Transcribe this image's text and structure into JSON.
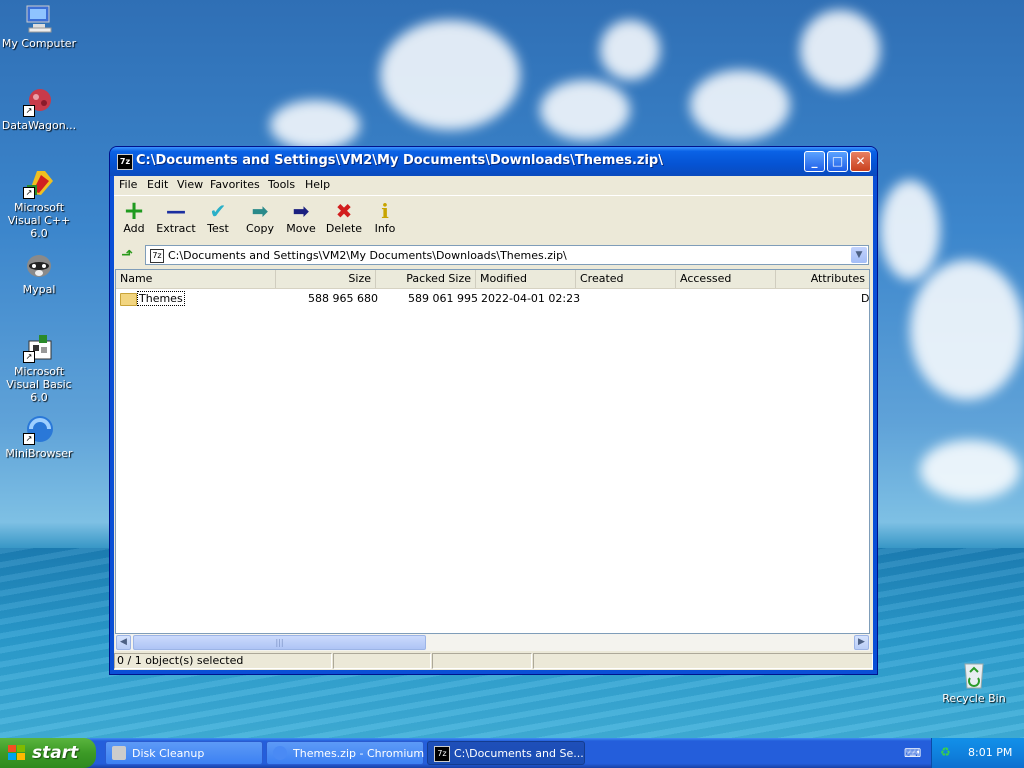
{
  "desktop": {
    "icons": [
      {
        "label": "My Computer"
      },
      {
        "label": "DataWagon..."
      },
      {
        "label": "Microsoft Visual C++ 6.0"
      },
      {
        "label": "Mypal"
      },
      {
        "label": "Microsoft Visual Basic 6.0"
      },
      {
        "label": "MiniBrowser"
      },
      {
        "label": "Recycle Bin"
      }
    ]
  },
  "window": {
    "title": "C:\\Documents and Settings\\VM2\\My Documents\\Downloads\\Themes.zip\\",
    "app_icon": "7z",
    "controls": {
      "minimize": "_",
      "maximize": "□",
      "close": "✕"
    },
    "menu": [
      "File",
      "Edit",
      "View",
      "Favorites",
      "Tools",
      "Help"
    ],
    "toolbar": [
      {
        "label": "Add",
        "icon": "plus-icon",
        "glyph": "+",
        "color": "#1f9a1f"
      },
      {
        "label": "Extract",
        "icon": "minus-icon",
        "glyph": "—",
        "color": "#1b2fa0"
      },
      {
        "label": "Test",
        "icon": "check-icon",
        "glyph": "✔",
        "color": "#2ab0c8"
      },
      {
        "label": "Copy",
        "icon": "arrow-right-icon",
        "glyph": "➡",
        "color": "#2a8a8a"
      },
      {
        "label": "Move",
        "icon": "arrow-right-icon",
        "glyph": "➡",
        "color": "#1b2080"
      },
      {
        "label": "Delete",
        "icon": "x-icon",
        "glyph": "✖",
        "color": "#d21d1d"
      },
      {
        "label": "Info",
        "icon": "info-icon",
        "glyph": "i",
        "color": "#c8a400"
      }
    ],
    "address": "C:\\Documents and Settings\\VM2\\My Documents\\Downloads\\Themes.zip\\",
    "columns": [
      "Name",
      "Size",
      "Packed Size",
      "Modified",
      "Created",
      "Accessed",
      "Attributes"
    ],
    "rows": [
      {
        "name": "Themes",
        "size": "588 965 680",
        "packed": "589 061 995",
        "modified": "2022-04-01 02:23",
        "created": "",
        "accessed": "",
        "attributes": "D"
      }
    ],
    "status": "0 / 1 object(s) selected"
  },
  "taskbar": {
    "start": "start",
    "tasks": [
      {
        "label": "Disk Cleanup",
        "icon": "disk-cleanup-icon"
      },
      {
        "label": "Themes.zip - Chromium",
        "icon": "chromium-icon"
      },
      {
        "label": "C:\\Documents and Se...",
        "icon": "7z-icon"
      }
    ],
    "clock": "8:01 PM"
  },
  "colors": {
    "xp_blue": "#0a4fd6",
    "start_green": "#3c9a26",
    "window_bg": "#ece9d8"
  }
}
